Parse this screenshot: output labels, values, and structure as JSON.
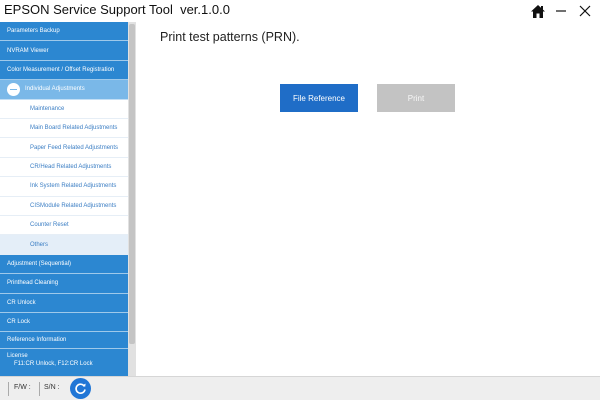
{
  "app": {
    "title": "EPSON Service Support Tool  ver.1.0.0"
  },
  "titlebar_icons": [
    "home-icon",
    "minimize-icon",
    "close-icon"
  ],
  "sidebar": {
    "items": [
      {
        "label": "Parameters Backup"
      },
      {
        "label": "NVRAM Viewer"
      },
      {
        "label": "Color Measurement / Offset Registration"
      },
      {
        "label": "Individual Adjustments"
      },
      {
        "label": "Maintenance"
      },
      {
        "label": "Main Board Related Adjustments"
      },
      {
        "label": "Paper Feed Related Adjustments"
      },
      {
        "label": "CR/Head Related Adjustments"
      },
      {
        "label": "Ink System Related Adjustments"
      },
      {
        "label": "CISModule Related Adjustments"
      },
      {
        "label": "Counter Reset"
      },
      {
        "label": "Others"
      },
      {
        "label": "Adjustment (Sequential)"
      },
      {
        "label": "Printhead Cleaning"
      },
      {
        "label": "CR Unlock"
      },
      {
        "label": "CR Lock"
      },
      {
        "label": "Reference Information"
      }
    ],
    "license": {
      "label": "License",
      "sub": "F11:CR Unlock, F12:CR Lock"
    }
  },
  "main": {
    "description": "Print test patterns (PRN).",
    "file_reference_label": "File Reference",
    "print_label": "Print"
  },
  "status": {
    "fw_label": "F/W :",
    "sn_label": "S/N :"
  },
  "colors": {
    "sidebar": "#2c87d1",
    "accent": "#1f6dc7",
    "disabled": "#c3c3c3"
  }
}
